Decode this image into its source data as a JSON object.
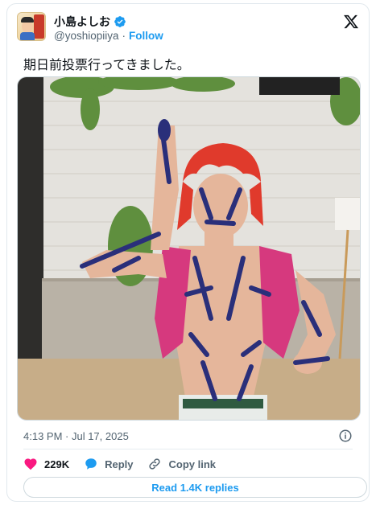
{
  "author": {
    "display_name": "小島よしお",
    "handle": "@yoshiopiiya",
    "separator": "·",
    "follow_label": "Follow",
    "verified": true,
    "avatar_icon": "profile-avatar"
  },
  "tweet": {
    "text": "期日前投票行ってきました。",
    "timestamp": "4:13 PM · Jul 17, 2025"
  },
  "actions": {
    "likes_count": "229K",
    "reply_label": "Reply",
    "copy_link_label": "Copy link"
  },
  "replies": {
    "read_label": "Read 1.4K replies"
  },
  "colors": {
    "accent": "#1d9bf0",
    "like": "#f91880",
    "text": "#0f1419",
    "muted": "#536471"
  },
  "icons": [
    "verified-badge-icon",
    "x-logo-icon",
    "info-icon",
    "heart-icon",
    "reply-bubble-icon",
    "link-icon"
  ]
}
